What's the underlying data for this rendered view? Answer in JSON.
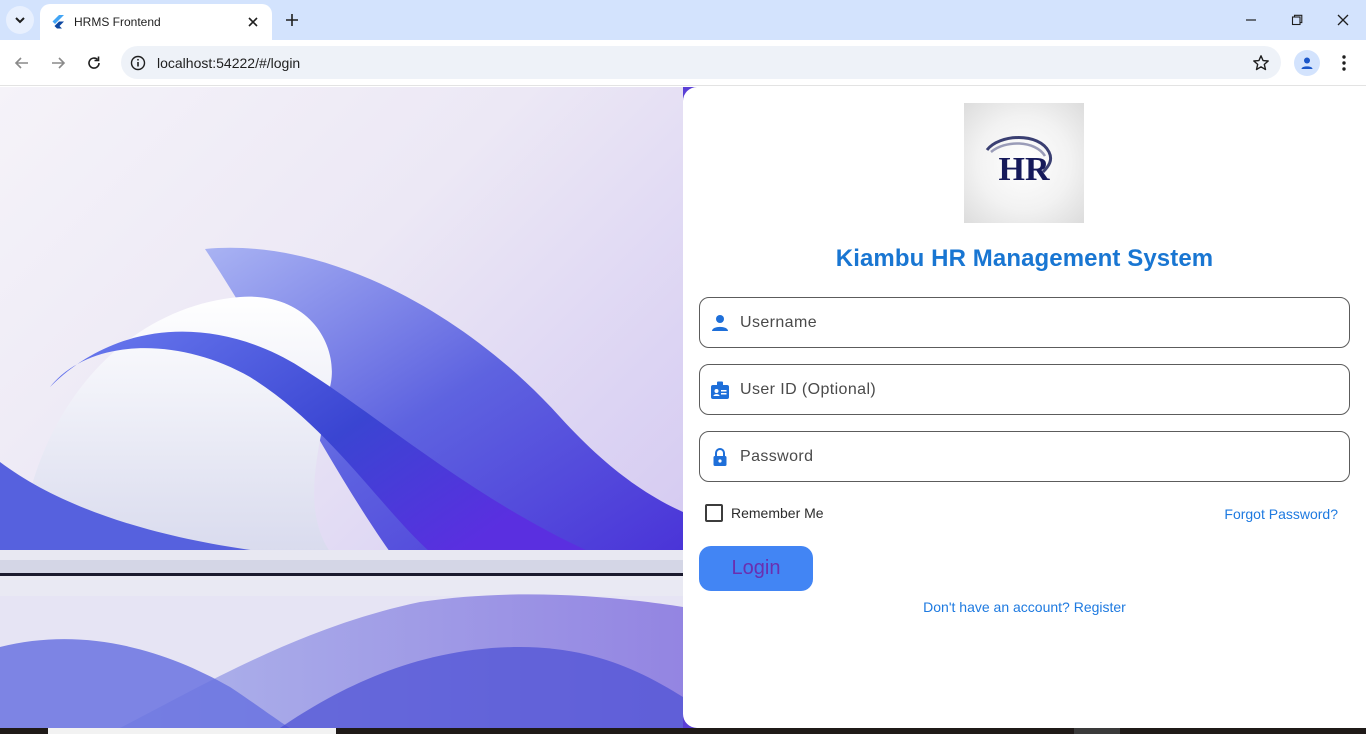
{
  "browser": {
    "tab_title": "HRMS Frontend",
    "url": "localhost:54222/#/login",
    "icons": {
      "tab_menu": "chevron-down-icon",
      "favicon": "flutter-icon",
      "tab_close": "close-icon",
      "new_tab": "plus-icon",
      "minimize": "minimize-icon",
      "restore": "restore-icon",
      "close_window": "close-icon",
      "back": "arrow-left-icon",
      "forward": "arrow-right-icon",
      "reload": "reload-icon",
      "site_info": "info-icon",
      "bookmark": "star-icon",
      "profile": "person-icon",
      "menu": "more-vert-icon"
    }
  },
  "login": {
    "logo_text": "HR",
    "title": "Kiambu HR Management System",
    "username_placeholder": "Username",
    "userid_placeholder": "User ID (Optional)",
    "password_placeholder": "Password",
    "remember_label": "Remember Me",
    "remember_checked": false,
    "forgot_label": "Forgot Password?",
    "login_label": "Login",
    "register_label": "Don't have an account? Register"
  },
  "colors": {
    "accent": "#1976d2",
    "button": "#4285f4",
    "link": "#1e7ae0",
    "icon": "#1e6fd9"
  }
}
